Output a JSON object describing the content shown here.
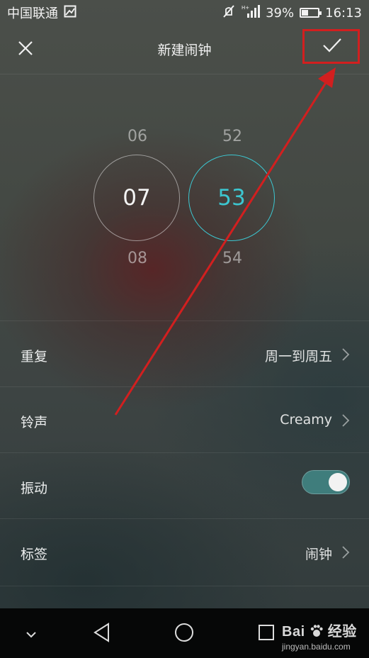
{
  "status_bar": {
    "carrier": "中国联通",
    "battery_percent": "39%",
    "battery_level": 0.39,
    "time": "16:13",
    "icons": [
      "image-icon",
      "mute-icon",
      "signal-icon",
      "battery-icon"
    ]
  },
  "header": {
    "title": "新建闹钟",
    "close_icon": "close-icon",
    "confirm_icon": "check-icon"
  },
  "time_picker": {
    "hour": {
      "prev": "06",
      "selected": "07",
      "next": "08"
    },
    "minute": {
      "prev": "52",
      "selected": "53",
      "next": "54"
    },
    "accent_color": "#3cc6d0"
  },
  "settings": {
    "repeat": {
      "label": "重复",
      "value": "周一到周五"
    },
    "ringtone": {
      "label": "铃声",
      "value": "Creamy"
    },
    "vibrate": {
      "label": "振动",
      "enabled": true
    },
    "tag": {
      "label": "标签",
      "value": "闹钟"
    }
  },
  "nav_bar": {
    "icons": [
      "chevron-down-icon",
      "back-icon",
      "home-icon",
      "recents-icon"
    ]
  },
  "watermark": {
    "brand_prefix": "Bai",
    "brand_suffix": "经验",
    "url": "jingyan.baidu.com"
  },
  "annotation": {
    "color": "#d21f1f"
  }
}
